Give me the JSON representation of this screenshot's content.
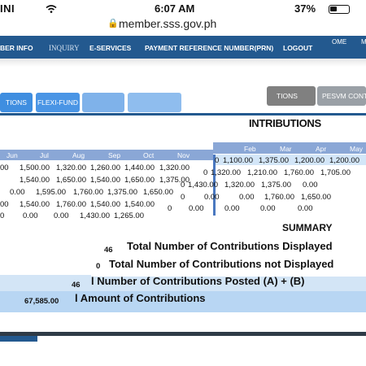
{
  "status": {
    "carrier": "INI",
    "time": "6:07 AM",
    "battery": "37%"
  },
  "browser": {
    "url": "member.sss.gov.ph"
  },
  "nav": {
    "items": [
      "BER INFO",
      "INQUIRY",
      "E-SERVICES",
      "PAYMENT REFERENCE NUMBER(PRN)",
      "LOGOUT"
    ],
    "home": "OME",
    "extra": "M"
  },
  "tabs": {
    "left": [
      "TIONS",
      "FLEXI-FUND",
      "",
      ""
    ],
    "right": [
      "TIONS",
      "PESVM CONTR"
    ]
  },
  "section": {
    "title": "INTRIBUTIONS"
  },
  "left_table": {
    "headers": [
      "Jun",
      "Jul",
      "Aug",
      "Sep",
      "Oct",
      "Nov"
    ],
    "rows": [
      [
        "00",
        "1,500.00",
        "1,320.00",
        "1,260.00",
        "1,440.00",
        "1,320.00"
      ],
      [
        "",
        "1,540.00",
        "1,650.00",
        "1,540.00",
        "1,650.00",
        "1,375.00"
      ],
      [
        "",
        "0.00",
        "1,595.00",
        "1,760.00",
        "1,375.00",
        "1,650.00"
      ],
      [
        "00",
        "1,540.00",
        "1,760.00",
        "1,540.00",
        "1,540.00",
        ""
      ],
      [
        "0",
        "0.00",
        "0.00",
        "1,430.00",
        "1,265.00",
        ""
      ]
    ]
  },
  "right_table": {
    "headers": [
      "Feb",
      "Mar",
      "Apr",
      "May"
    ],
    "rows": [
      [
        "0",
        "1,100.00",
        "1,375.00",
        "1,200.00",
        "1,200.00"
      ],
      [
        "0",
        "1,320.00",
        "1,210.00",
        "1,760.00",
        "1,705.00"
      ],
      [
        "0",
        "1,430.00",
        "1,320.00",
        "1,375.00",
        "0.00"
      ],
      [
        "0",
        "0.00",
        "0.00",
        "1,760.00",
        "1,650.00"
      ],
      [
        "0",
        "0.00",
        "0.00",
        "0.00",
        "0.00"
      ]
    ]
  },
  "summary": {
    "title": "SUMMARY",
    "lines": [
      {
        "label": "Total Number of Contributions Displayed",
        "value": "46"
      },
      {
        "label": "Total Number of Contributions not Displayed",
        "value": "0"
      },
      {
        "label": "l Number of Contributions Posted (A) + (B)",
        "value": "46"
      },
      {
        "label": "l Amount of Contributions",
        "value": "67,585.00"
      }
    ]
  }
}
